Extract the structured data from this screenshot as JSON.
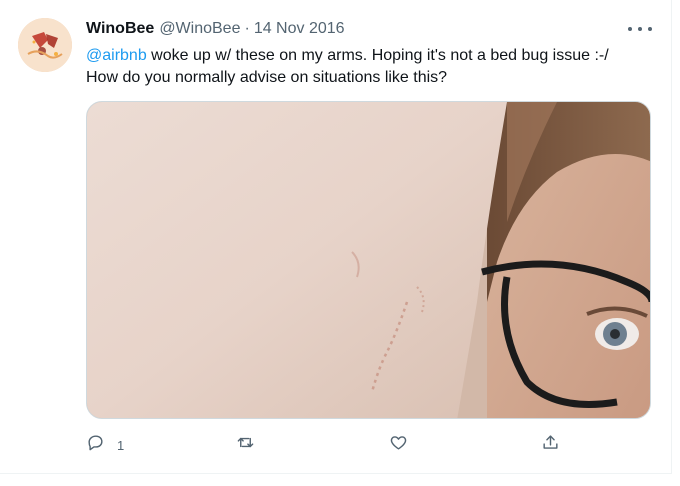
{
  "tweet": {
    "author_name": "WinoBee",
    "author_handle": "@WinoBee",
    "separator": "·",
    "date": "14 Nov 2016",
    "text_mention": "@airbnb",
    "text_line1_rest": " woke up w/ these on my arms. Hoping it's not a bed bug issue :-/",
    "text_line2": "How do you normally advise on situations like this?",
    "more_icon": "more-horizontal-icon"
  },
  "actions": {
    "reply_count": "1",
    "reply_icon": "reply-icon",
    "retweet_icon": "retweet-icon",
    "like_icon": "heart-icon",
    "share_icon": "share-icon"
  },
  "colors": {
    "text": "#0f1419",
    "secondary": "#536471",
    "link": "#1d9bf0",
    "border": "#eff3f4"
  }
}
